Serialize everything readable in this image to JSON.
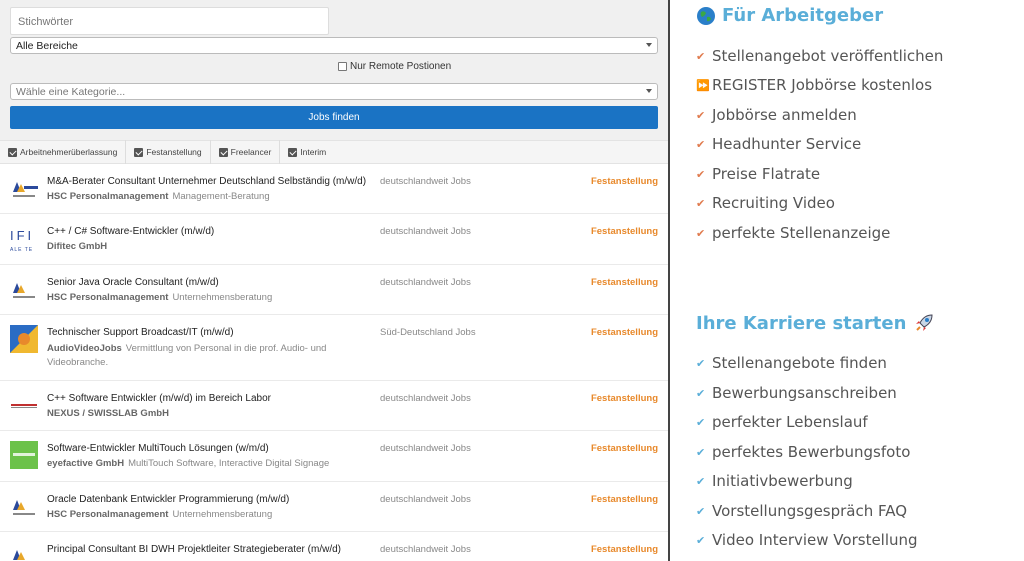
{
  "search": {
    "keywords_placeholder": "Stichwörter",
    "bereich_selected": "Alle Bereiche",
    "remote_label": "Nur Remote Postionen",
    "kategorie_placeholder": "Wähle eine Kategorie...",
    "find_button": "Jobs finden"
  },
  "filters": [
    {
      "label": "Arbeitnehmerüberlassung",
      "checked": true
    },
    {
      "label": "Festanstellung",
      "checked": true
    },
    {
      "label": "Freelancer",
      "checked": true
    },
    {
      "label": "Interim",
      "checked": true
    }
  ],
  "jobs": [
    {
      "title": "M&A-Berater Consultant Unternehmer Deutschland Selbständig (m/w/d)",
      "company": "HSC Personalmanagement",
      "desc": "Management-Beratung",
      "region": "deutschlandweit Jobs",
      "type": "Festanstellung",
      "logo": "hsc-logo"
    },
    {
      "title": "C++ / C# Software-Entwickler (m/w/d)",
      "company": "Difitec GmbH",
      "desc": "",
      "region": "deutschlandweit Jobs",
      "type": "Festanstellung",
      "logo": "difitec-logo"
    },
    {
      "title": "Senior Java Oracle Consultant (m/w/d)",
      "company": "HSC Personalmanagement",
      "desc": "Unternehmensberatung",
      "region": "deutschlandweit Jobs",
      "type": "Festanstellung",
      "logo": "hsc-logo"
    },
    {
      "title": "Technischer Support Broadcast/IT (m/w/d)",
      "company": "AudioVideoJobs",
      "desc": "Vermittlung von Personal in die prof. Audio- und Videobranche.",
      "region": "Süd-Deutschland Jobs",
      "type": "Festanstellung",
      "logo": "audiovideojobs-logo"
    },
    {
      "title": "C++ Software Entwickler (m/w/d) im Bereich Labor",
      "company": "NEXUS / SWISSLAB GmbH",
      "desc": "",
      "region": "deutschlandweit Jobs",
      "type": "Festanstellung",
      "logo": "nexus-logo"
    },
    {
      "title": "Software-Entwickler MultiTouch Lösungen (w/m/d)",
      "company": "eyefactive GmbH",
      "desc": "MultiTouch Software, Interactive Digital Signage",
      "region": "deutschlandweit Jobs",
      "type": "Festanstellung",
      "logo": "eyefactive-logo"
    },
    {
      "title": "Oracle Datenbank Entwickler Programmierung (m/w/d)",
      "company": "HSC Personalmanagement",
      "desc": "Unternehmensberatung",
      "region": "deutschlandweit Jobs",
      "type": "Festanstellung",
      "logo": "hsc-logo"
    },
    {
      "title": "Principal Consultant BI DWH Projektleiter Strategieberater (m/w/d)",
      "company": "",
      "desc": "",
      "region": "deutschlandweit Jobs",
      "type": "Festanstellung",
      "logo": "hsc-logo"
    }
  ],
  "employer": {
    "heading": "Für Arbeitgeber",
    "icon": "globe-icon",
    "items": [
      {
        "label": "Stellenangebot veröffentlichen",
        "icon": "check-icon"
      },
      {
        "label": "REGISTER Jobbörse kostenlos",
        "icon": "fast-forward-icon"
      },
      {
        "label": "Jobbörse anmelden",
        "icon": "check-icon"
      },
      {
        "label": "Headhunter Service",
        "icon": "check-icon"
      },
      {
        "label": "Preise Flatrate",
        "icon": "check-icon"
      },
      {
        "label": "Recruiting Video",
        "icon": "check-icon"
      },
      {
        "label": "perfekte Stellenanzeige",
        "icon": "check-icon"
      }
    ]
  },
  "career": {
    "heading": "Ihre Karriere starten",
    "icon": "rocket-icon",
    "items": [
      {
        "label": "Stellenangebote finden"
      },
      {
        "label": "Bewerbungsanschreiben"
      },
      {
        "label": "perfekter Lebenslauf"
      },
      {
        "label": "perfektes Bewerbungsfoto"
      },
      {
        "label": "Initiativbewerbung"
      },
      {
        "label": "Vorstellungsgespräch FAQ"
      },
      {
        "label": "Video Interview Vorstellung"
      }
    ]
  },
  "colors": {
    "accent_blue": "#1a73c4",
    "heading_blue": "#5aaed8",
    "type_orange": "#e8892b",
    "check_red": "#e07a4d"
  }
}
